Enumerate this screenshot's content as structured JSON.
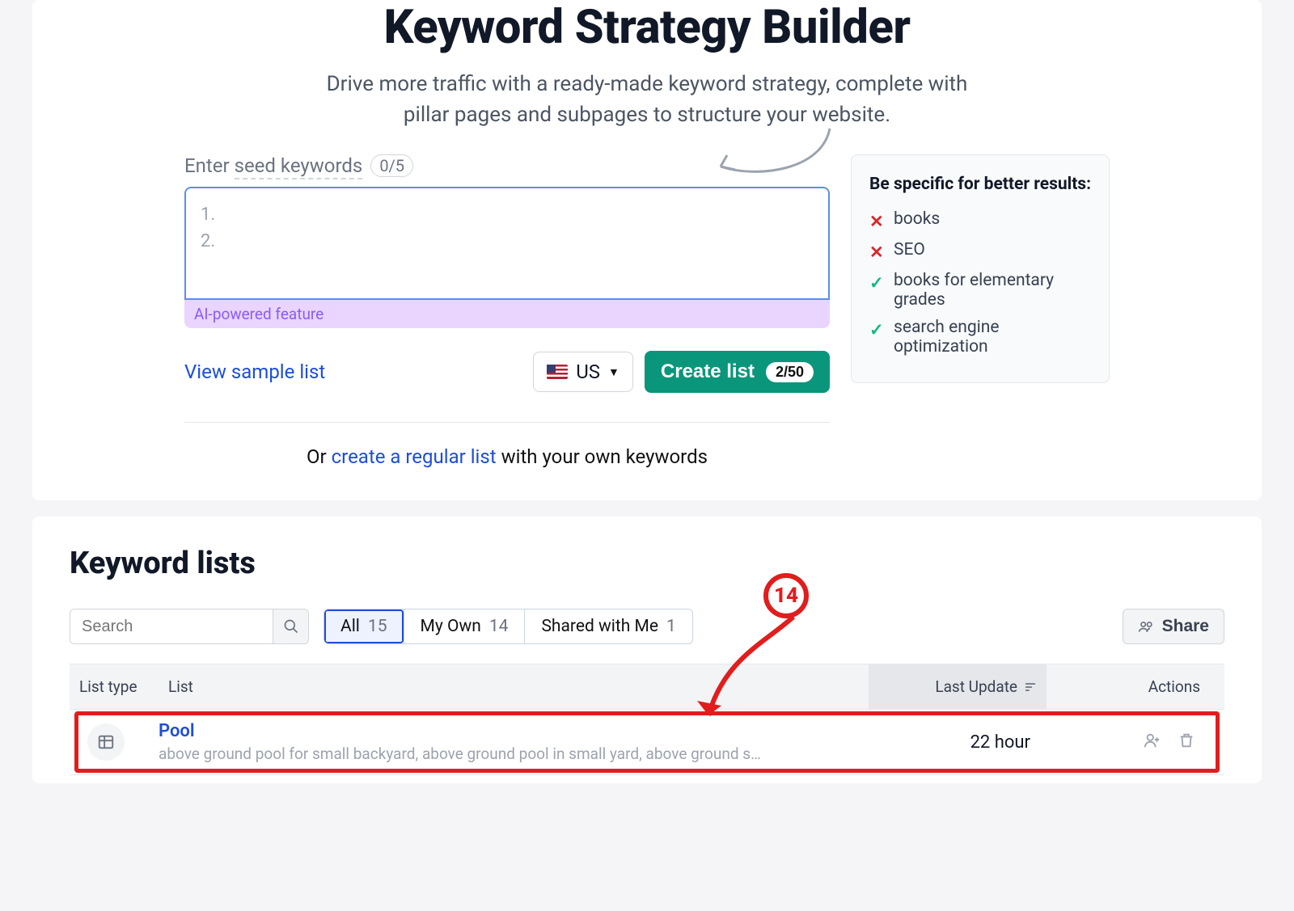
{
  "hero": {
    "title": "Keyword Strategy Builder",
    "subtitle": "Drive more traffic with a ready-made keyword strategy, complete with pillar pages and subpages to structure your website."
  },
  "seed": {
    "label_prefix": "Enter ",
    "label_underline": "seed keywords",
    "counter": "0/5",
    "placeholder1": "1.",
    "placeholder2": "2.",
    "ai_tag": "AI-powered feature"
  },
  "actions": {
    "sample_link": "View sample list",
    "country_code": "US",
    "create_label": "Create list",
    "create_counter": "2/50",
    "or_prefix": "Or ",
    "or_link": "create a regular list",
    "or_suffix": " with your own keywords"
  },
  "tips": {
    "title": "Be specific for better results:",
    "items": [
      {
        "good": false,
        "text": "books"
      },
      {
        "good": false,
        "text": "SEO"
      },
      {
        "good": true,
        "text": "books for elementary grades"
      },
      {
        "good": true,
        "text": "search engine optimization"
      }
    ]
  },
  "lists": {
    "title": "Keyword lists",
    "search_placeholder": "Search",
    "tabs": [
      {
        "label": "All",
        "count": "15",
        "active": true
      },
      {
        "label": "My Own",
        "count": "14",
        "active": false
      },
      {
        "label": "Shared with Me",
        "count": "1",
        "active": false
      }
    ],
    "share_label": "Share",
    "columns": {
      "type": "List type",
      "list": "List",
      "updated": "Last Update",
      "actions": "Actions"
    },
    "rows": [
      {
        "name": "Pool",
        "desc": "above ground pool for small backyard, above ground pool in small yard, above ground s…",
        "updated": "22 hour"
      }
    ],
    "annotation_number": "14"
  }
}
